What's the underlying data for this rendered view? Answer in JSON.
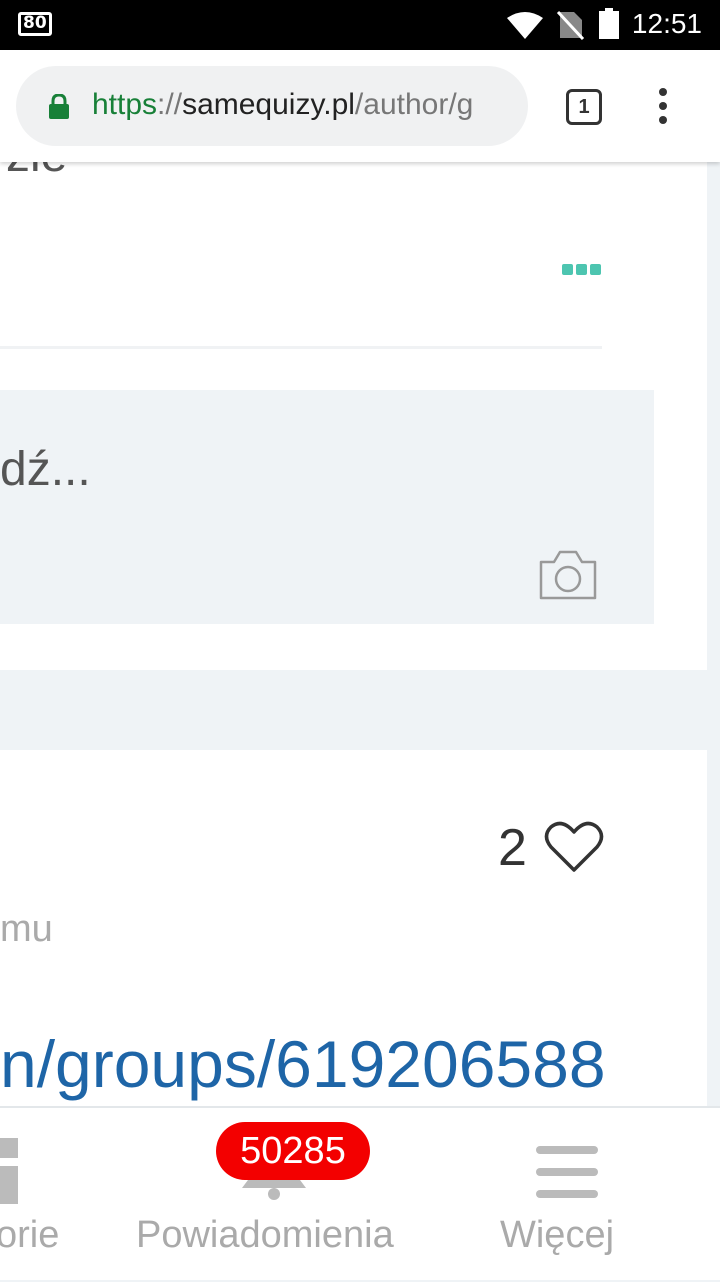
{
  "status_bar": {
    "left_indicator": "80",
    "time": "12:51",
    "icons": [
      "wifi-icon",
      "no-sim-icon",
      "battery-icon"
    ]
  },
  "browser": {
    "url_scheme": "https",
    "url_sep": "://",
    "url_host": "samequizy.pl",
    "url_path": "/author/g",
    "tab_count": "1",
    "icons": [
      "lock-icon",
      "overflow-menu-icon"
    ]
  },
  "post": {
    "partial_text": "zie",
    "comment_placeholder": "dź...",
    "icons": [
      "more-dots-icon",
      "camera-icon"
    ]
  },
  "post2": {
    "likes": "2",
    "meta_text": "mu",
    "link_text": "n/groups/619206588",
    "icons": [
      "heart-icon"
    ]
  },
  "bottom_nav": {
    "categories_label": "orie",
    "notifications_label": "Powiadomienia",
    "notifications_badge": "50285",
    "more_label": "Więcej",
    "icons": [
      "categories-icon",
      "bell-icon",
      "hamburger-icon"
    ]
  },
  "colors": {
    "accent_teal": "#4dc5b0",
    "link_blue": "#1e65a7",
    "badge_red": "#f30000",
    "secure_green": "#188038"
  }
}
